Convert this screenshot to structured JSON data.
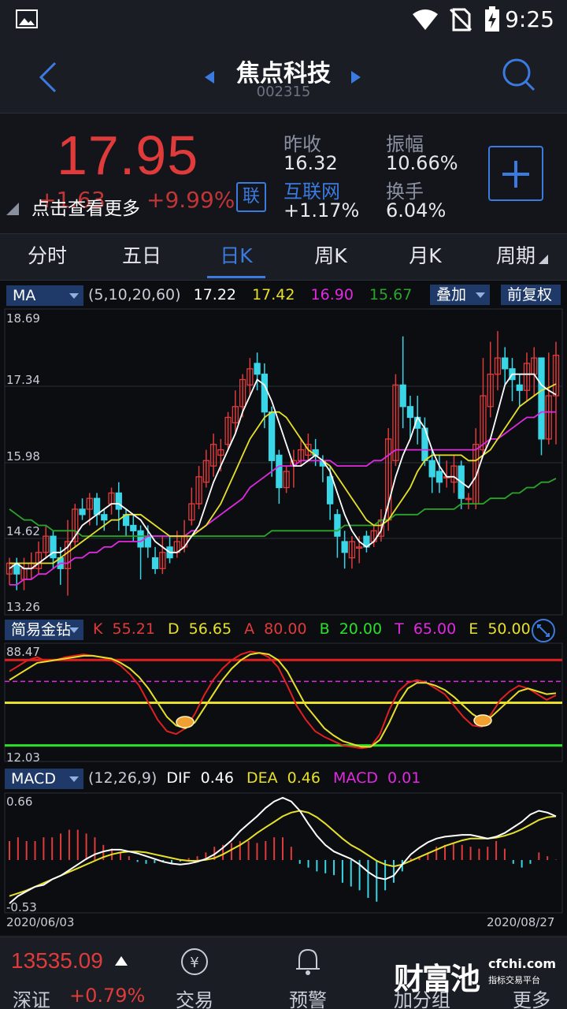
{
  "status_bar": {
    "time": "9:25"
  },
  "header": {
    "title": "焦点科技",
    "code": "002315"
  },
  "quote": {
    "price": "17.95",
    "change": "+1.63",
    "change_pct": "+9.99%",
    "tap_more": "点击查看更多",
    "lian": "联",
    "prev_close_label": "昨收",
    "prev_close": "16.32",
    "amplitude_label": "振幅",
    "amplitude": "10.66%",
    "sector_label": "互联网",
    "sector_change": "+1.17%",
    "turnover_label": "换手",
    "turnover": "6.04%"
  },
  "tabs": [
    "分时",
    "五日",
    "日K",
    "周K",
    "月K",
    "周期"
  ],
  "active_tab": 2,
  "ma": {
    "label": "MA",
    "params": "(5,10,20,60)",
    "v1": "17.22",
    "v2": "17.42",
    "v3": "16.90",
    "v4": "15.67",
    "overlay": "叠加",
    "adjust": "前复权",
    "y_labels": [
      "18.69",
      "17.34",
      "15.98",
      "14.62",
      "13.26"
    ]
  },
  "kdj": {
    "label": "简易金钻",
    "k_label": "K",
    "k": "55.21",
    "d_label": "D",
    "d": "56.65",
    "a_label": "A",
    "a": "80.00",
    "b_label": "B",
    "b": "20.00",
    "t_label": "T",
    "t": "65.00",
    "e_label": "E",
    "e": "50.00",
    "y_top": "88.47",
    "y_bottom": "12.03"
  },
  "macd": {
    "label": "MACD",
    "params": "(12,26,9)",
    "dif_label": "DIF",
    "dif": "0.46",
    "dea_label": "DEA",
    "dea": "0.46",
    "macd_label": "MACD",
    "macd": "0.01",
    "y_top": "0.66",
    "y_bottom": "-0.53",
    "date_start": "2020/06/03",
    "date_end": "2020/08/27"
  },
  "bottom_bar": {
    "index_value": "13535.09",
    "index_name": "深证",
    "index_pct": "+0.79%",
    "trade": "交易",
    "alert": "预警",
    "add_group": "加分组",
    "more": "更多",
    "brand": "财富池",
    "brand_url": "cfchi.com",
    "brand_sub": "指标交易平台"
  },
  "colors": {
    "up": "#e03b3b",
    "down": "#38d6e6",
    "accent": "#3b7be0",
    "ma5": "#ffffff",
    "ma10": "#e6e02a",
    "ma20": "#e02ae0",
    "ma60": "#2aa52a"
  },
  "chart_data": {
    "type": "candlestick",
    "x_start": "2020/06/03",
    "x_end": "2020/08/27",
    "ylim": [
      13.26,
      18.69
    ],
    "candles": [
      [
        13.9,
        14.1,
        14.2,
        13.7
      ],
      [
        14.1,
        13.9,
        14.2,
        13.6
      ],
      [
        13.8,
        14.0,
        14.2,
        13.6
      ],
      [
        14.0,
        14.1,
        14.3,
        13.8
      ],
      [
        14.0,
        14.3,
        14.5,
        13.9
      ],
      [
        14.3,
        14.6,
        14.8,
        14.2
      ],
      [
        14.6,
        14.2,
        14.7,
        14.0
      ],
      [
        14.2,
        14.0,
        14.4,
        13.7
      ],
      [
        14.0,
        14.5,
        14.9,
        13.5
      ],
      [
        14.5,
        15.1,
        15.2,
        14.4
      ],
      [
        15.1,
        15.0,
        15.3,
        14.9
      ],
      [
        15.1,
        15.3,
        15.4,
        14.8
      ],
      [
        15.3,
        15.0,
        15.4,
        14.8
      ],
      [
        15.0,
        14.9,
        15.1,
        14.7
      ],
      [
        15.2,
        15.4,
        15.5,
        15.0
      ],
      [
        15.4,
        15.1,
        15.6,
        14.7
      ],
      [
        15.0,
        14.8,
        15.1,
        14.6
      ],
      [
        14.8,
        14.7,
        15.0,
        14.5
      ],
      [
        14.7,
        14.4,
        14.8,
        13.8
      ],
      [
        14.6,
        14.4,
        14.8,
        14.2
      ],
      [
        14.2,
        14.0,
        14.4,
        13.9
      ],
      [
        14.0,
        14.3,
        14.6,
        13.9
      ],
      [
        14.4,
        14.2,
        14.6,
        14.1
      ],
      [
        14.3,
        14.5,
        14.7,
        14.2
      ],
      [
        14.4,
        14.6,
        14.9,
        14.3
      ],
      [
        14.9,
        15.2,
        15.5,
        14.8
      ],
      [
        15.2,
        15.7,
        15.9,
        15.1
      ],
      [
        15.6,
        16.0,
        16.2,
        15.5
      ],
      [
        15.9,
        16.3,
        16.5,
        15.7
      ],
      [
        16.1,
        16.2,
        16.4,
        15.8
      ],
      [
        16.3,
        16.8,
        16.9,
        16.2
      ],
      [
        16.7,
        17.0,
        17.3,
        16.5
      ],
      [
        17.0,
        17.5,
        17.6,
        16.8
      ],
      [
        17.4,
        17.7,
        17.9,
        17.2
      ],
      [
        17.8,
        17.6,
        18.0,
        17.3
      ],
      [
        17.6,
        16.9,
        17.8,
        16.6
      ],
      [
        16.9,
        16.0,
        17.0,
        15.7
      ],
      [
        16.1,
        15.5,
        16.2,
        15.2
      ],
      [
        15.5,
        15.8,
        15.9,
        15.4
      ],
      [
        15.9,
        16.0,
        16.2,
        15.5
      ],
      [
        16.0,
        16.2,
        16.4,
        15.9
      ],
      [
        16.1,
        16.3,
        16.5,
        16.0
      ],
      [
        16.2,
        16.1,
        16.4,
        15.9
      ],
      [
        16.0,
        15.9,
        16.1,
        15.6
      ],
      [
        15.7,
        15.2,
        15.9,
        14.9
      ],
      [
        15.0,
        14.6,
        15.1,
        14.2
      ],
      [
        14.5,
        14.3,
        14.7,
        14.0
      ],
      [
        14.2,
        14.5,
        14.6,
        14.0
      ],
      [
        14.4,
        14.4,
        14.6,
        14.1
      ],
      [
        14.6,
        14.4,
        14.7,
        14.3
      ],
      [
        14.5,
        14.7,
        14.8,
        14.4
      ],
      [
        14.6,
        14.9,
        15.1,
        14.5
      ],
      [
        14.9,
        16.4,
        16.6,
        14.7
      ],
      [
        16.0,
        17.4,
        17.6,
        15.9
      ],
      [
        17.4,
        17.0,
        18.3,
        16.6
      ],
      [
        17.0,
        16.8,
        17.2,
        16.4
      ],
      [
        16.8,
        16.6,
        17.2,
        16.3
      ],
      [
        16.6,
        16.0,
        16.8,
        15.9
      ],
      [
        16.0,
        15.7,
        16.2,
        15.4
      ],
      [
        15.8,
        15.6,
        16.1,
        15.4
      ],
      [
        15.7,
        15.7,
        16.0,
        15.5
      ],
      [
        15.6,
        15.9,
        16.1,
        15.4
      ],
      [
        15.9,
        15.3,
        16.0,
        15.1
      ],
      [
        15.3,
        15.3,
        15.4,
        15.1
      ],
      [
        15.2,
        16.3,
        16.6,
        15.1
      ],
      [
        16.2,
        17.2,
        17.9,
        16.1
      ],
      [
        17.0,
        17.6,
        18.2,
        16.8
      ],
      [
        17.6,
        17.9,
        18.4,
        17.3
      ],
      [
        17.9,
        17.7,
        18.1,
        17.4
      ],
      [
        17.7,
        17.5,
        17.9,
        17.1
      ],
      [
        17.4,
        17.3,
        17.6,
        17.0
      ],
      [
        17.3,
        17.8,
        18.0,
        17.1
      ],
      [
        17.6,
        17.9,
        18.1,
        17.2
      ],
      [
        17.9,
        16.4,
        17.3,
        16.1
      ],
      [
        16.4,
        17.2,
        18.0,
        16.3
      ],
      [
        17.2,
        17.95,
        18.2,
        16.3
      ]
    ],
    "ma5": [
      14.0,
      14.1,
      14.0,
      14.0,
      14.1,
      14.2,
      14.3,
      14.3,
      14.4,
      14.6,
      14.8,
      14.9,
      15.0,
      15.1,
      15.2,
      15.2,
      15.1,
      15.0,
      14.9,
      14.7,
      14.5,
      14.4,
      14.3,
      14.3,
      14.4,
      14.6,
      14.8,
      15.2,
      15.6,
      15.9,
      16.2,
      16.5,
      16.9,
      17.2,
      17.5,
      17.4,
      17.1,
      16.7,
      16.3,
      15.9,
      15.9,
      16.0,
      16.1,
      16.0,
      15.8,
      15.4,
      15.0,
      14.7,
      14.5,
      14.4,
      14.5,
      14.7,
      15.2,
      15.7,
      16.1,
      16.4,
      16.8,
      16.6,
      16.2,
      15.9,
      15.7,
      15.7,
      15.6,
      15.5,
      15.7,
      16.1,
      16.4,
      16.9,
      17.4,
      17.6,
      17.6,
      17.6,
      17.6,
      17.4,
      17.3,
      17.22
    ],
    "ma10": [
      14.1,
      14.1,
      14.1,
      14.1,
      14.1,
      14.1,
      14.1,
      14.2,
      14.3,
      14.4,
      14.5,
      14.6,
      14.7,
      14.8,
      14.9,
      14.9,
      15.0,
      15.0,
      15.0,
      14.9,
      14.8,
      14.7,
      14.6,
      14.6,
      14.6,
      14.6,
      14.7,
      14.8,
      15.0,
      15.2,
      15.5,
      15.8,
      16.1,
      16.4,
      16.6,
      16.8,
      16.9,
      16.9,
      16.8,
      16.6,
      16.4,
      16.2,
      16.1,
      16.0,
      15.9,
      15.7,
      15.5,
      15.3,
      15.1,
      14.9,
      14.8,
      14.8,
      14.9,
      15.1,
      15.3,
      15.5,
      15.8,
      16.0,
      16.1,
      16.1,
      16.1,
      16.1,
      16.1,
      16.0,
      16.0,
      16.1,
      16.2,
      16.4,
      16.6,
      16.8,
      17.0,
      17.1,
      17.2,
      17.3,
      17.35,
      17.42
    ],
    "ma20": [
      13.7,
      13.7,
      13.8,
      13.8,
      13.9,
      13.9,
      14.0,
      14.1,
      14.1,
      14.2,
      14.2,
      14.3,
      14.3,
      14.4,
      14.4,
      14.5,
      14.5,
      14.5,
      14.5,
      14.6,
      14.6,
      14.6,
      14.6,
      14.6,
      14.6,
      14.7,
      14.7,
      14.8,
      14.9,
      15.0,
      15.1,
      15.2,
      15.3,
      15.5,
      15.6,
      15.7,
      15.8,
      15.9,
      15.9,
      15.9,
      16.0,
      16.0,
      16.0,
      16.0,
      16.0,
      15.9,
      15.9,
      15.9,
      15.9,
      15.9,
      16.0,
      16.0,
      16.1,
      16.2,
      16.2,
      16.2,
      16.2,
      16.2,
      16.2,
      16.2,
      16.2,
      16.2,
      16.2,
      16.2,
      16.2,
      16.3,
      16.4,
      16.4,
      16.5,
      16.6,
      16.7,
      16.8,
      16.8,
      16.9,
      16.9,
      16.9
    ],
    "ma60": [
      15.1,
      15.0,
      14.9,
      14.9,
      14.8,
      14.8,
      14.7,
      14.7,
      14.7,
      14.7,
      14.6,
      14.6,
      14.6,
      14.6,
      14.6,
      14.6,
      14.6,
      14.6,
      14.6,
      14.6,
      14.6,
      14.6,
      14.6,
      14.6,
      14.6,
      14.6,
      14.6,
      14.6,
      14.6,
      14.6,
      14.6,
      14.6,
      14.6,
      14.6,
      14.6,
      14.6,
      14.7,
      14.7,
      14.7,
      14.7,
      14.7,
      14.7,
      14.7,
      14.7,
      14.7,
      14.7,
      14.8,
      14.8,
      14.8,
      14.8,
      14.8,
      14.9,
      14.9,
      15.0,
      15.0,
      15.0,
      15.0,
      15.1,
      15.1,
      15.1,
      15.1,
      15.1,
      15.2,
      15.2,
      15.2,
      15.2,
      15.3,
      15.3,
      15.3,
      15.4,
      15.4,
      15.5,
      15.5,
      15.6,
      15.6,
      15.67
    ],
    "kdj_k": [
      72,
      76,
      80,
      82,
      79,
      80,
      82,
      83,
      84,
      83,
      82,
      80,
      76,
      70,
      62,
      50,
      38,
      30,
      28,
      32,
      42,
      55,
      66,
      74,
      80,
      84,
      86,
      85,
      82,
      75,
      62,
      48,
      38,
      30,
      26,
      23,
      20,
      19,
      18,
      19,
      28,
      45,
      58,
      64,
      66,
      64,
      60,
      56,
      48,
      40,
      34,
      33,
      42,
      52,
      58,
      62,
      60,
      56,
      52,
      55.21
    ],
    "kdj_d": [
      66,
      70,
      74,
      78,
      79,
      80,
      81,
      82,
      83,
      83,
      82,
      81,
      78,
      74,
      68,
      60,
      50,
      40,
      34,
      32,
      36,
      46,
      56,
      66,
      74,
      80,
      84,
      85,
      84,
      80,
      72,
      60,
      48,
      40,
      32,
      27,
      23,
      21,
      19,
      19,
      24,
      36,
      50,
      60,
      64,
      64,
      62,
      59,
      54,
      48,
      42,
      38,
      40,
      46,
      52,
      58,
      60,
      58,
      56,
      56.65
    ],
    "macd_dif": [
      -0.48,
      -0.4,
      -0.35,
      -0.3,
      -0.28,
      -0.22,
      -0.18,
      -0.12,
      -0.06,
      0.0,
      0.05,
      0.08,
      0.1,
      0.1,
      0.08,
      0.06,
      0.03,
      0.0,
      -0.03,
      -0.05,
      -0.06,
      -0.05,
      -0.03,
      0.0,
      0.05,
      0.12,
      0.2,
      0.3,
      0.38,
      0.46,
      0.55,
      0.62,
      0.66,
      0.62,
      0.52,
      0.38,
      0.25,
      0.15,
      0.08,
      0.04,
      0.0,
      -0.06,
      -0.14,
      -0.2,
      -0.22,
      -0.18,
      -0.06,
      0.05,
      0.12,
      0.18,
      0.22,
      0.24,
      0.25,
      0.26,
      0.26,
      0.24,
      0.22,
      0.24,
      0.28,
      0.34,
      0.4,
      0.48,
      0.52,
      0.5,
      0.46
    ],
    "macd_dea": [
      -0.4,
      -0.37,
      -0.34,
      -0.3,
      -0.26,
      -0.22,
      -0.18,
      -0.14,
      -0.1,
      -0.06,
      -0.02,
      0.02,
      0.05,
      0.07,
      0.08,
      0.08,
      0.07,
      0.05,
      0.03,
      0.01,
      -0.01,
      -0.02,
      -0.02,
      -0.01,
      0.01,
      0.05,
      0.1,
      0.15,
      0.21,
      0.28,
      0.34,
      0.4,
      0.46,
      0.5,
      0.52,
      0.5,
      0.45,
      0.38,
      0.3,
      0.22,
      0.15,
      0.1,
      0.04,
      -0.02,
      -0.06,
      -0.08,
      -0.06,
      -0.02,
      0.02,
      0.06,
      0.1,
      0.14,
      0.17,
      0.2,
      0.22,
      0.22,
      0.22,
      0.23,
      0.25,
      0.28,
      0.32,
      0.37,
      0.42,
      0.45,
      0.46
    ],
    "macd_hist": [
      0.5,
      0.6,
      0.5,
      0.5,
      0.6,
      0.6,
      0.7,
      0.8,
      0.8,
      0.7,
      0.6,
      0.4,
      0.3,
      0.2,
      0.1,
      -0.05,
      -0.1,
      -0.08,
      -0.05,
      -0.1,
      -0.04,
      0.05,
      0.1,
      0.2,
      0.35,
      0.4,
      0.45,
      0.5,
      0.5,
      0.45,
      0.5,
      0.6,
      0.6,
      0.35,
      -0.1,
      -0.2,
      -0.3,
      -0.35,
      -0.4,
      -0.6,
      -0.7,
      -0.8,
      -1.0,
      -1.1,
      -0.8,
      -0.6,
      -0.3,
      0.05,
      0.1,
      0.2,
      0.35,
      0.4,
      0.45,
      0.4,
      0.35,
      0.3,
      0.35,
      0.5,
      0.3,
      -0.1,
      -0.2,
      -0.1,
      0.2,
      0.1,
      0.01
    ]
  }
}
